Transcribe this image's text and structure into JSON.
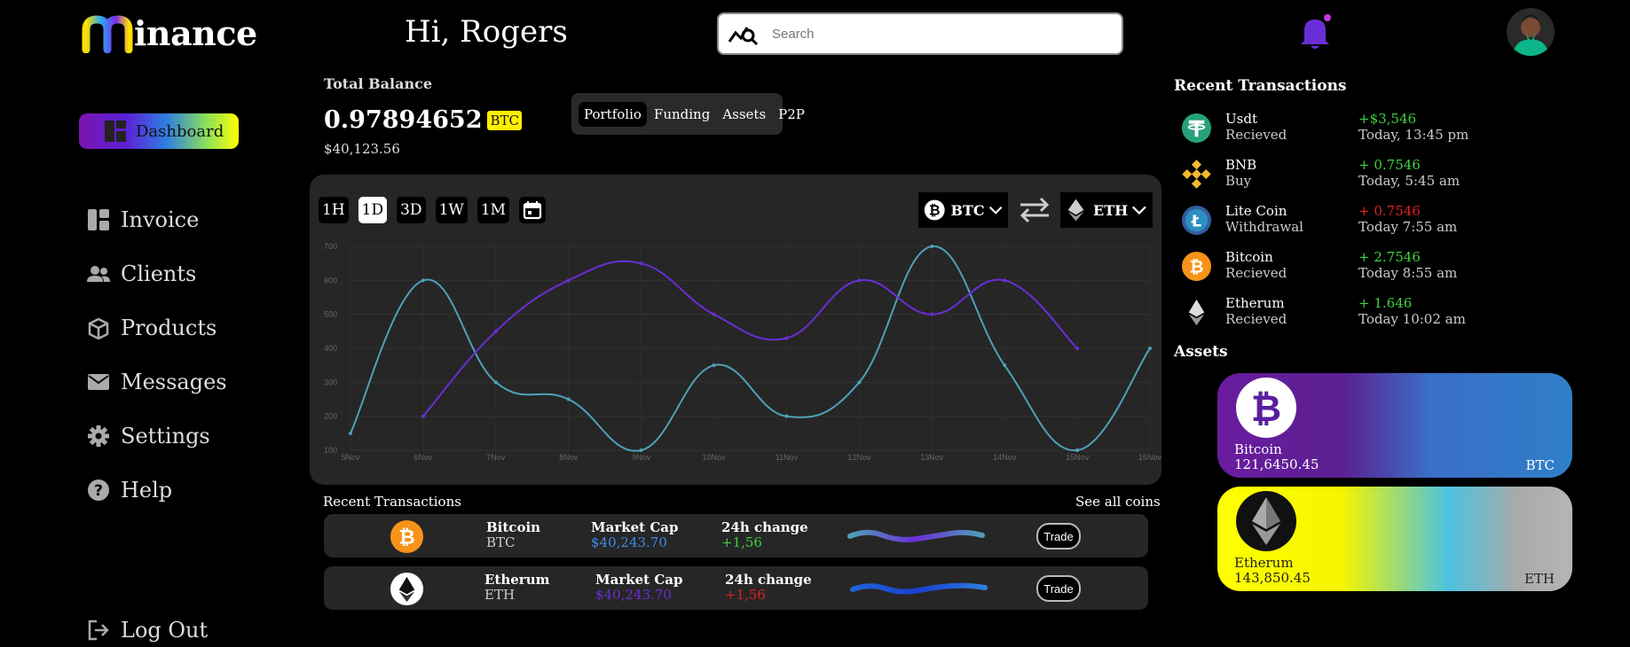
{
  "brand": {
    "logo_text": "inance"
  },
  "header": {
    "greeting": "Hi, Rogers",
    "search_placeholder": "Search"
  },
  "sidebar": {
    "active": "Dashboard",
    "items": [
      {
        "label": "Invoice",
        "icon": "invoice-icon"
      },
      {
        "label": "Clients",
        "icon": "clients-icon"
      },
      {
        "label": "Products",
        "icon": "products-icon"
      },
      {
        "label": "Messages",
        "icon": "messages-icon"
      },
      {
        "label": "Settings",
        "icon": "settings-icon"
      },
      {
        "label": "Help",
        "icon": "help-icon"
      }
    ],
    "logout": "Log Out"
  },
  "balance": {
    "label": "Total Balance",
    "value": "0.97894652",
    "unit": "BTC",
    "fiat": "$40,123.56"
  },
  "tabs": [
    "Portfolio",
    "Funding",
    "Assets",
    "P2P"
  ],
  "chart_controls": {
    "timeframes": [
      "1H",
      "1D",
      "3D",
      "1W",
      "1M"
    ],
    "active_timeframe": "1D",
    "from_coin": "BTC",
    "to_coin": "ETH"
  },
  "chart_data": {
    "type": "line",
    "x": [
      "5Nov",
      "6Nov",
      "7Nov",
      "8Nov",
      "9Nov",
      "10Nov",
      "11Nov",
      "12Nov",
      "13Nov",
      "14Nov",
      "15Nov",
      "16Nov"
    ],
    "yticks": [
      "100",
      "200",
      "300",
      "400",
      "500",
      "600",
      "700"
    ],
    "ylim": [
      100,
      700
    ],
    "series": [
      {
        "color": "#4ea1b8",
        "values": [
          150,
          600,
          300,
          250,
          100,
          350,
          200,
          300,
          700,
          350,
          100,
          400
        ]
      },
      {
        "color": "#6a2ed6",
        "values": [
          null,
          200,
          450,
          600,
          650,
          500,
          430,
          600,
          500,
          600,
          400,
          null
        ]
      }
    ],
    "grid": true
  },
  "coin_list": {
    "title": "Recent Transactions",
    "see_all": "See all coins",
    "rows": [
      {
        "name": "Bitcoin",
        "symbol": "BTC",
        "mcap_label": "Market Cap",
        "mcap": "$40,243.70",
        "mcap_color": "#3c8ee8",
        "change_label": "24h change",
        "change": "+1,56",
        "change_color": "#3fd13f",
        "trade": "Trade",
        "icon": "bitcoin-icon"
      },
      {
        "name": "Etherum",
        "symbol": "ETH",
        "mcap_label": "Market Cap",
        "mcap": "$40,243.70",
        "mcap_color": "#6a2ed6",
        "change_label": "24h change",
        "change": "+1,56",
        "change_color": "#e02020",
        "trade": "Trade",
        "icon": "ethereum-icon"
      }
    ]
  },
  "recent_transactions": {
    "title": "Recent Transactions",
    "items": [
      {
        "name": "Usdt",
        "type": "Recieved",
        "amount": "+$3,546",
        "amount_color": "#3fd13f",
        "time": "Today, 13:45 pm",
        "icon": "tether-icon"
      },
      {
        "name": "BNB",
        "type": "Buy",
        "amount": "+ 0.7546",
        "amount_color": "#3fd13f",
        "time": "Today, 5:45 am",
        "icon": "bnb-icon"
      },
      {
        "name": "Lite Coin",
        "type": "Withdrawal",
        "amount": "+ 0.7546",
        "amount_color": "#e02020",
        "time": "Today 7:55 am",
        "icon": "litecoin-icon"
      },
      {
        "name": "Bitcoin",
        "type": "Recieved",
        "amount": "+ 2.7546",
        "amount_color": "#3fd13f",
        "time": "Today 8:55 am",
        "icon": "bitcoin-icon"
      },
      {
        "name": "Etherum",
        "type": "Recieved",
        "amount": "+ 1.646",
        "amount_color": "#3fd13f",
        "time": "Today 10:02 am",
        "icon": "ethereum-icon"
      }
    ]
  },
  "assets": {
    "title": "Assets",
    "items": [
      {
        "name": "Bitcoin",
        "amount": "121,6450.45",
        "symbol": "BTC",
        "icon": "bitcoin-icon"
      },
      {
        "name": "Etherum",
        "amount": "143,850.45",
        "symbol": "ETH",
        "icon": "ethereum-icon"
      }
    ]
  }
}
